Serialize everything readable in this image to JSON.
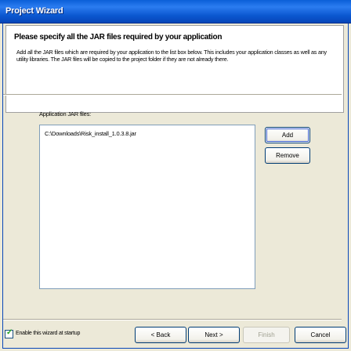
{
  "window": {
    "title": "Project Wizard"
  },
  "header": {
    "heading": "Please specify all the JAR files required by your application",
    "description": "Add all the JAR files which are required by your application to the list box below. This includes your application classes as well as any utility libraries. The JAR files will be copied to the project folder if they are not already there."
  },
  "jars": {
    "label": "Application JAR files:",
    "items": [
      "C:\\Downloads\\Risk_install_1.0.3.8.jar"
    ],
    "add_label": "Add",
    "remove_label": "Remove"
  },
  "footer": {
    "startup_checkbox_label": "Enable this wizard at startup",
    "startup_checked": true,
    "back_label": "< Back",
    "next_label": "Next >",
    "finish_label": "Finish",
    "cancel_label": "Cancel"
  }
}
